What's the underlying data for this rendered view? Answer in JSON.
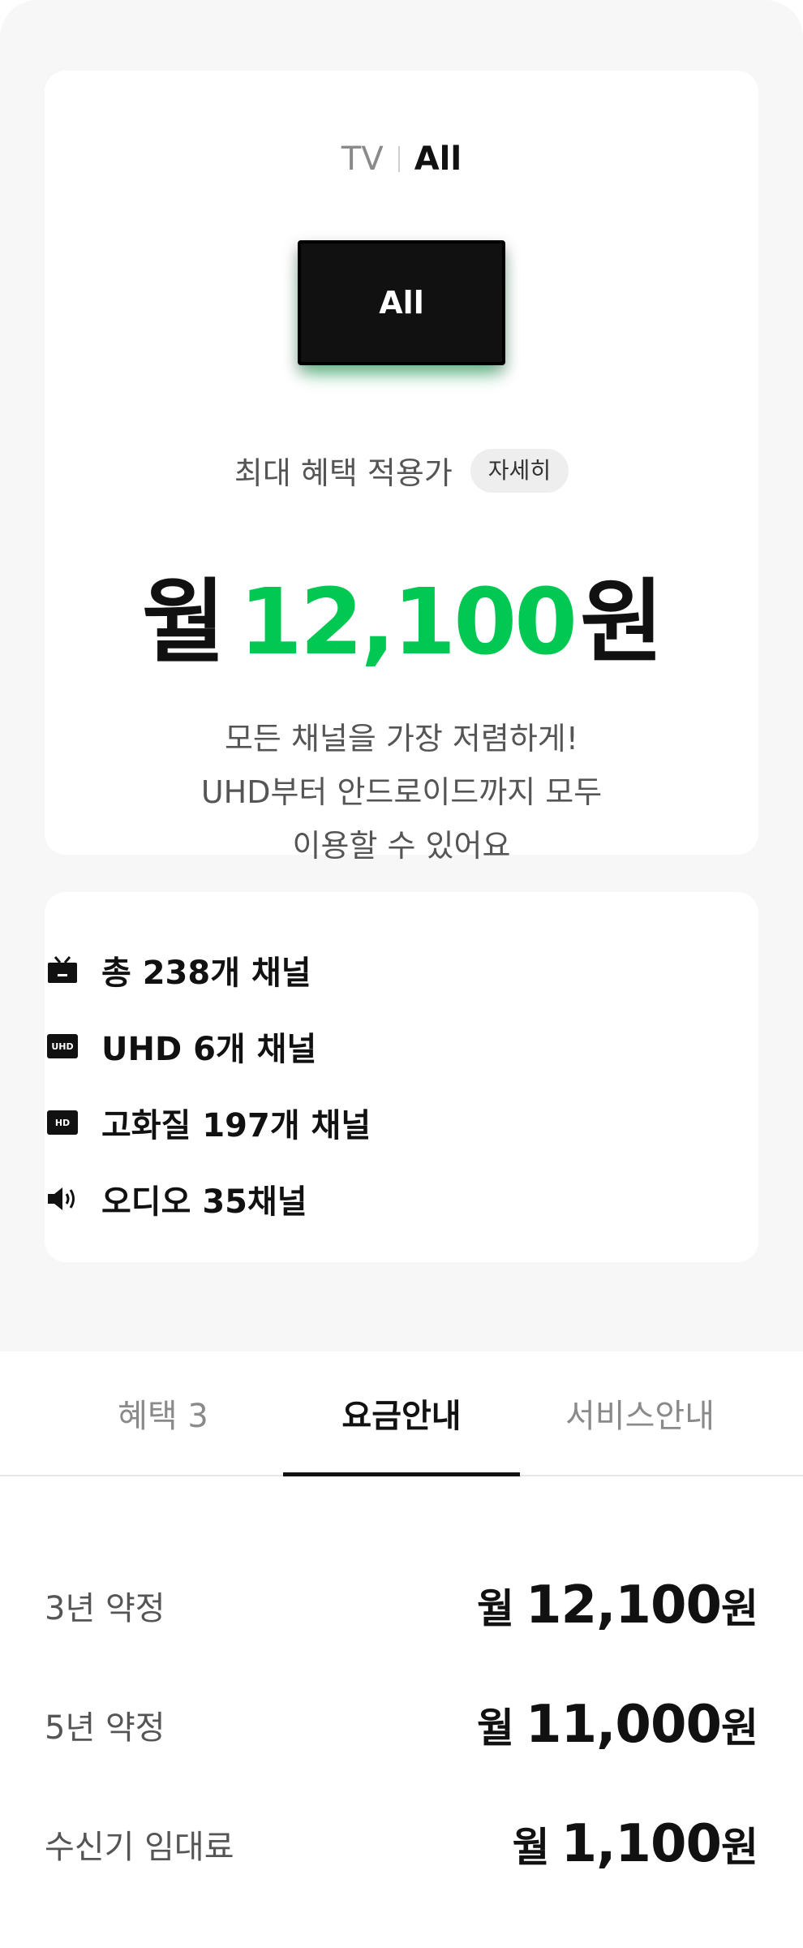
{
  "header": {
    "breadcrumb_tv": "TV",
    "breadcrumb_product": "All",
    "tv_screen_label": "All"
  },
  "summary": {
    "benefit_label": "최대 혜택 적용가",
    "detail_button": "자세히",
    "price_prefix": "월",
    "price_value": "12,100",
    "price_suffix": "원",
    "description_line1": "모든 채널을 가장 저렴하게!",
    "description_line2": "UHD부터 안드로이드까지 모두",
    "description_line3": "이용할 수 있어요"
  },
  "features": [
    {
      "icon": "tv-icon",
      "label": "총 238개 채널"
    },
    {
      "icon": "uhd-icon",
      "icon_text": "UHD",
      "label": "UHD 6개 채널"
    },
    {
      "icon": "hd-icon",
      "icon_text": "HD",
      "label": "고화질 197개 채널"
    },
    {
      "icon": "speaker-icon",
      "label": "오디오 35채널"
    }
  ],
  "tabs": [
    {
      "label": "혜택 3",
      "active": false
    },
    {
      "label": "요금안내",
      "active": true
    },
    {
      "label": "서비스안내",
      "active": false
    }
  ],
  "fees": [
    {
      "label": "3년 약정",
      "prefix": "월",
      "value": "12,100",
      "suffix": "원"
    },
    {
      "label": "5년 약정",
      "prefix": "월",
      "value": "11,000",
      "suffix": "원"
    },
    {
      "label": "수신기 임대료",
      "prefix": "월",
      "value": "1,100",
      "suffix": "원"
    }
  ],
  "colors": {
    "accent_green": "#00c853",
    "background_gray": "#f7f7f7",
    "text_primary": "#111111",
    "text_secondary": "#555555"
  }
}
